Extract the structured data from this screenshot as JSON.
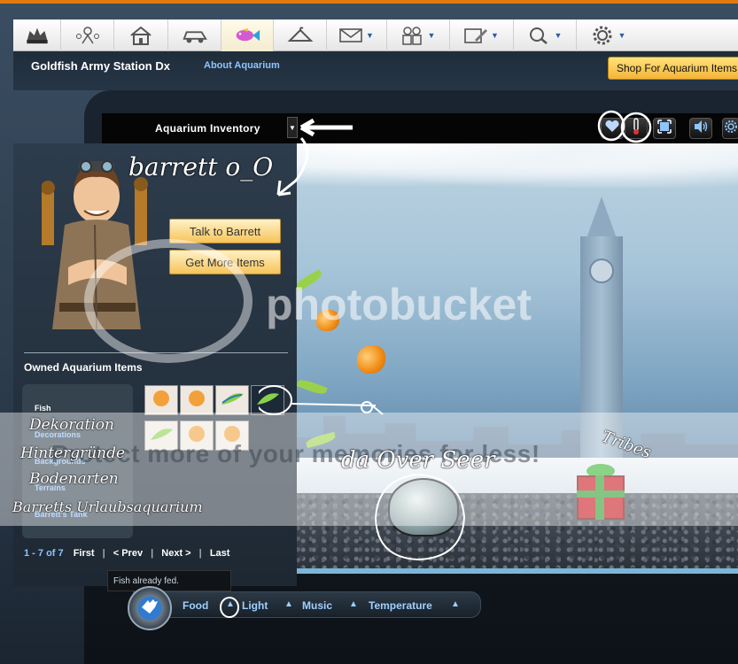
{
  "nav": {
    "items": [
      {
        "icon": "gaia-logo-icon",
        "label": "GAIA"
      },
      {
        "icon": "people-network-icon"
      },
      {
        "icon": "house-icon"
      },
      {
        "icon": "car-icon"
      },
      {
        "icon": "fish-icon"
      },
      {
        "icon": "hanger-icon"
      },
      {
        "icon": "mail-icon"
      },
      {
        "icon": "friends-icon"
      },
      {
        "icon": "pencil-icon"
      },
      {
        "icon": "search-icon"
      },
      {
        "icon": "gear-icon"
      }
    ]
  },
  "header": {
    "title": "Goldfish Army Station Dx",
    "about_link": "About Aquarium",
    "shop_button": "Shop For Aquarium Items"
  },
  "inventory": {
    "title": "Aquarium Inventory"
  },
  "npc": {
    "talk_button": "Talk to Barrett",
    "more_button": "Get More Items"
  },
  "owned": {
    "title": "Owned Aquarium Items",
    "categories": [
      "Fish",
      "Decorations",
      "Backgrounds",
      "Terrains",
      "Barrett's Tank"
    ],
    "pager": {
      "range": "1 - 7 of 7",
      "first": "First",
      "prev": "< Prev",
      "next": "Next >",
      "last": "Last"
    }
  },
  "status_message": "Fish already fed.",
  "controls": {
    "food": "Food",
    "light": "Light",
    "music": "Music",
    "temperature": "Temperature"
  },
  "annotations": {
    "barrett": "barrett o_O",
    "dekoration": "Dekoration",
    "hintergruende": "Hintergründe",
    "bodenarten": "Bodenarten",
    "urlaubsaquarium": "Barretts Urlaubsaquarium",
    "overseer": "da Over Seer",
    "tribes": "Tribes"
  },
  "watermark": {
    "brand": "photobucket",
    "promo": "Protect more of your memories for less!"
  },
  "colors": {
    "accent_orange": "#e07a10",
    "link_blue": "#8fc4ff",
    "gold_button": "#f6c45a"
  }
}
